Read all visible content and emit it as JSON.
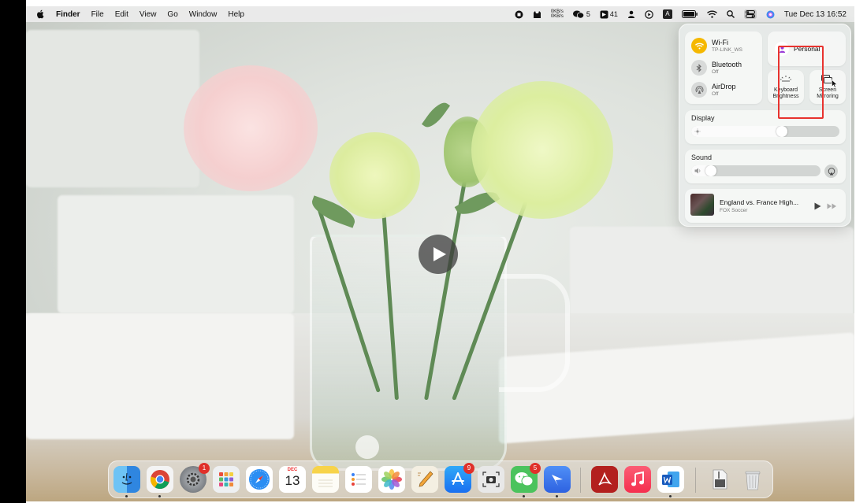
{
  "menubar": {
    "app_name": "Finder",
    "menus": [
      "File",
      "Edit",
      "View",
      "Go",
      "Window",
      "Help"
    ],
    "net_up": "0KB/s",
    "net_down": "0KB/s",
    "wechat_count": "5",
    "notify_count": "41",
    "input_source": "A",
    "clock": "Tue Dec 13  16:52"
  },
  "control_center": {
    "wifi": {
      "title": "Wi-Fi",
      "sub": "TP-LINK_WS",
      "color": "#f5b800"
    },
    "bluetooth": {
      "title": "Bluetooth",
      "sub": "Off"
    },
    "airdrop": {
      "title": "AirDrop",
      "sub": "Off"
    },
    "focus": {
      "title": "Personal",
      "color": "#9a3bd6"
    },
    "keyboard_brightness": {
      "line1": "Keyboard",
      "line2": "Brightness"
    },
    "screen_mirroring": {
      "line1": "Screen",
      "line2": "Mirroring"
    },
    "display": {
      "title": "Display",
      "level": 0.62
    },
    "sound": {
      "title": "Sound",
      "level": 0.12
    },
    "now_playing": {
      "title": "England vs. France High...",
      "subtitle": "FOX Soccer"
    }
  },
  "highlight_color": "#e8332f",
  "dock": {
    "apps": [
      {
        "name": "finder",
        "dot": true,
        "badge": ""
      },
      {
        "name": "chrome",
        "dot": true,
        "badge": ""
      },
      {
        "name": "system-settings",
        "dot": false,
        "badge": "1"
      },
      {
        "name": "launchpad",
        "dot": false,
        "badge": ""
      },
      {
        "name": "safari",
        "dot": false,
        "badge": ""
      },
      {
        "name": "calendar",
        "dot": false,
        "badge": "",
        "month": "DEC",
        "day": "13"
      },
      {
        "name": "notes",
        "dot": false,
        "badge": ""
      },
      {
        "name": "reminders",
        "dot": false,
        "badge": ""
      },
      {
        "name": "photos",
        "dot": false,
        "badge": ""
      },
      {
        "name": "pages",
        "dot": false,
        "badge": ""
      },
      {
        "name": "app-store",
        "dot": false,
        "badge": "9"
      },
      {
        "name": "screenshot",
        "dot": false,
        "badge": ""
      },
      {
        "name": "wechat",
        "dot": true,
        "badge": "5"
      },
      {
        "name": "feishu",
        "dot": true,
        "badge": ""
      },
      {
        "name": "acrobat",
        "dot": false,
        "badge": ""
      },
      {
        "name": "music",
        "dot": false,
        "badge": ""
      },
      {
        "name": "word",
        "dot": true,
        "badge": ""
      },
      {
        "name": "archive-utility",
        "dot": false,
        "badge": ""
      },
      {
        "name": "trash",
        "dot": false,
        "badge": ""
      }
    ]
  }
}
